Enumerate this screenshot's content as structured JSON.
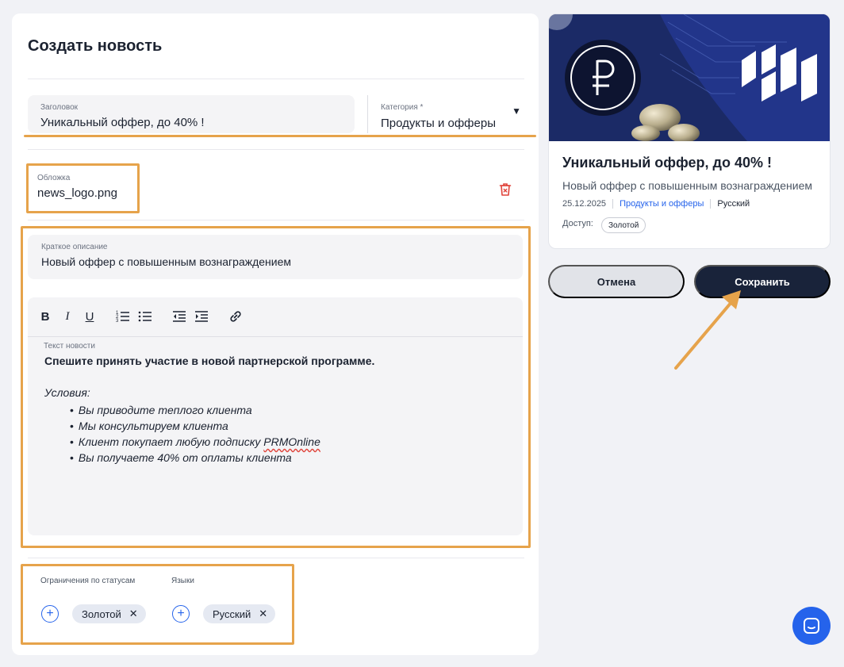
{
  "form": {
    "title": "Создать новость",
    "headline": {
      "label": "Заголовок",
      "value": "Уникальный оффер, до 40% !"
    },
    "category": {
      "label": "Категория *",
      "value": "Продукты и офферы"
    },
    "cover": {
      "label": "Обложка",
      "value": "news_logo.png"
    },
    "short_description": {
      "label": "Краткое описание",
      "value": "Новый оффер с повышенным вознаграждением"
    },
    "editor": {
      "label": "Текст новости",
      "bold_line": "Спешите принять участие в новой партнерской программе.",
      "conditions_title": "Условия:",
      "items": [
        "Вы приводите теплого клиента",
        "Мы консультируем клиента",
        "Клиент покупает любую подписку ",
        "Вы получаете 40% от оплаты клиента"
      ],
      "item_brand": "PRMOnline"
    },
    "restrictions": {
      "label": "Ограничения по статусам",
      "chip": "Золотой"
    },
    "languages": {
      "label": "Языки",
      "chip": "Русский"
    }
  },
  "preview": {
    "title": "Уникальный оффер, до 40% !",
    "description": "Новый оффер с повышенным вознаграждением",
    "date": "25.12.2025",
    "category": "Продукты и офферы",
    "language": "Русский",
    "access_label": "Доступ:",
    "access_value": "Золотой"
  },
  "actions": {
    "cancel": "Отмена",
    "save": "Сохранить"
  },
  "colors": {
    "highlight": "#e6a34b",
    "accent": "#2563eb",
    "primary_dark": "#19233a",
    "banner": "#1b2a66"
  }
}
